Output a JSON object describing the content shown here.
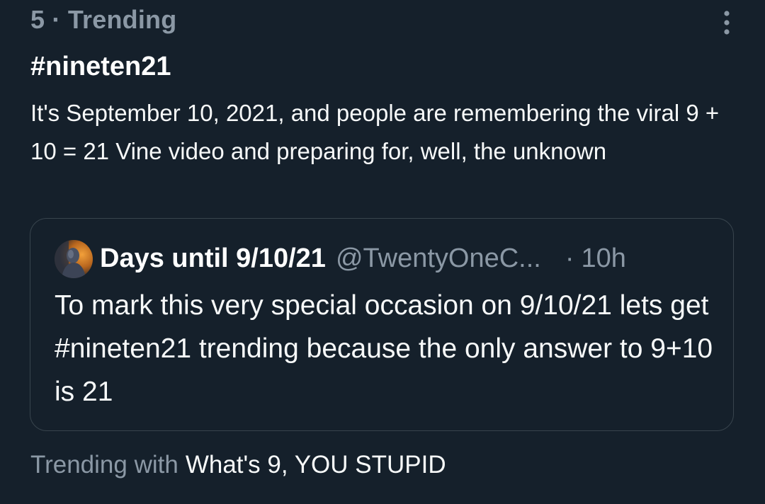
{
  "trend": {
    "meta": "5 · Trending",
    "hashtag": "#nineten21",
    "summary": "It's September 10, 2021, and people are remembering the viral 9 + 10 = 21 Vine video and preparing for, well, the unknown",
    "more_icon": "more-vertical-icon"
  },
  "quoted_tweet": {
    "avatar_icon": "avatar",
    "display_name": "Days until 9/10/21",
    "handle": "@TwentyOneC...",
    "separator": "·",
    "time": "10h",
    "text": "To mark this very special occasion on 9/10/21 lets get #nineten21 trending because the only answer to 9+10 is 21"
  },
  "trending_with": {
    "label": "Trending with",
    "topic": "What's 9, YOU STUPID"
  },
  "colors": {
    "background": "#15202b",
    "secondary_text": "#8b98a5",
    "primary_text": "#f7f9f9",
    "border": "#38444d"
  }
}
